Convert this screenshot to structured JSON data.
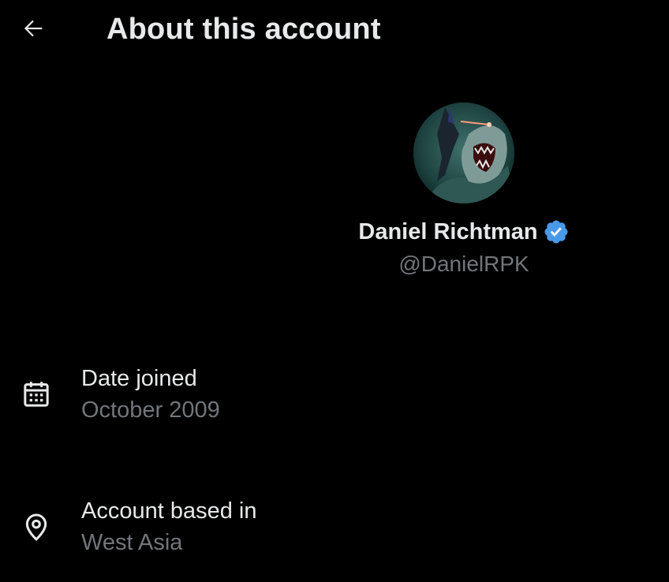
{
  "header": {
    "title": "About this account",
    "back_icon": "arrow-left-icon"
  },
  "profile": {
    "display_name": "Daniel Richtman",
    "handle": "@DanielRPK",
    "verified_icon": "verified-badge-icon",
    "verified_color": "#4a99e9"
  },
  "info": [
    {
      "icon": "calendar-icon",
      "label": "Date joined",
      "value": "October 2009"
    },
    {
      "icon": "location-pin-icon",
      "label": "Account based in",
      "value": "West Asia"
    }
  ],
  "colors": {
    "background": "#000000",
    "primary_text": "#e7e9ea",
    "secondary_text": "#71767b"
  }
}
